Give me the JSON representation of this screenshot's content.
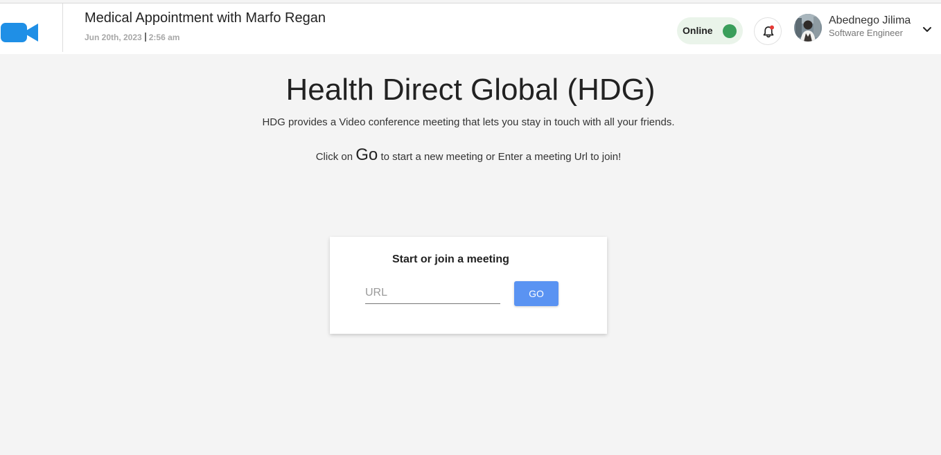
{
  "header": {
    "logo_icon": "video-camera-icon",
    "meeting_title": "Medical Appointment with Marfo Regan",
    "meeting_date": "Jun 20th, 2023",
    "meeting_time": "2:56 am",
    "status_label": "Online",
    "status_color": "#3a9e5b",
    "notification_icon": "bell-icon",
    "notification_badge_color": "#e53935",
    "user_name": "Abednego Jilima",
    "user_role": "Software Engineer",
    "dropdown_icon": "chevron-down-icon"
  },
  "hero": {
    "title": "Health Direct Global (HDG)",
    "subtitle": "HDG provides a Video conference meeting that lets you stay in touch with all your friends.",
    "instruction_prefix": "Click on",
    "instruction_go": "Go",
    "instruction_suffix": "to start a new meeting or Enter a meeting Url to join!"
  },
  "meeting_card": {
    "title": "Start or join a meeting",
    "url_placeholder": "URL",
    "url_value": "",
    "go_label": "GO",
    "accent_color": "#5a93f2"
  }
}
